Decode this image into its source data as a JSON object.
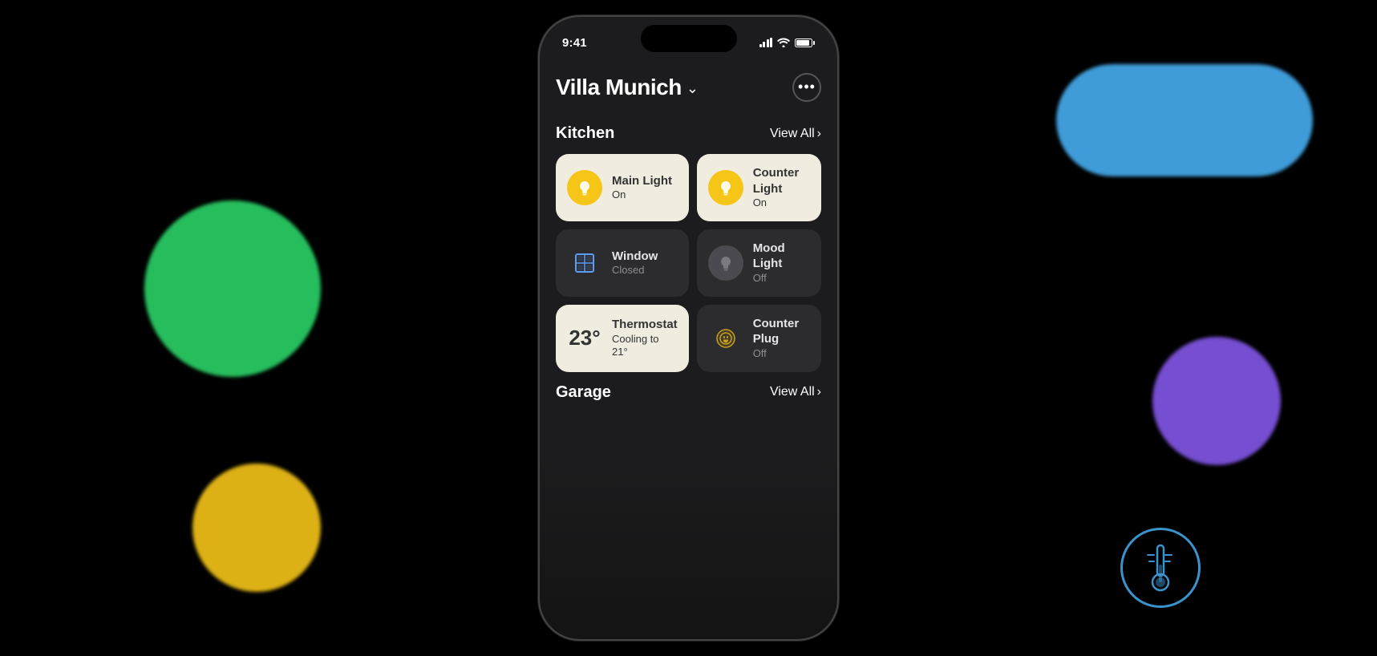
{
  "background": {
    "blobs": [
      "blue",
      "green",
      "yellow",
      "purple"
    ]
  },
  "status_bar": {
    "time": "9:41",
    "signal": "signal-icon",
    "wifi": "wifi-icon",
    "battery": "battery-icon"
  },
  "header": {
    "location_name": "Villa Munich",
    "chevron": "›",
    "more_button_label": "···"
  },
  "sections": [
    {
      "id": "kitchen",
      "title": "Kitchen",
      "view_all_label": "View All",
      "devices": [
        {
          "id": "main-light",
          "name": "Main Light",
          "status": "On",
          "state": "on",
          "icon_type": "bulb-on"
        },
        {
          "id": "counter-light",
          "name": "Counter Light",
          "status": "On",
          "state": "on",
          "icon_type": "bulb-on"
        },
        {
          "id": "window",
          "name": "Window",
          "status": "Closed",
          "state": "off",
          "icon_type": "window"
        },
        {
          "id": "mood-light",
          "name": "Mood Light",
          "status": "Off",
          "state": "off",
          "icon_type": "bulb-off"
        },
        {
          "id": "thermostat",
          "name": "Thermostat",
          "status": "Cooling to 21°",
          "state": "on",
          "icon_type": "thermostat",
          "temp": "23°"
        },
        {
          "id": "counter-plug",
          "name": "Counter Plug",
          "status": "Off",
          "state": "off",
          "icon_type": "plug"
        }
      ]
    },
    {
      "id": "garage",
      "title": "Garage",
      "view_all_label": "View All",
      "devices": []
    }
  ]
}
